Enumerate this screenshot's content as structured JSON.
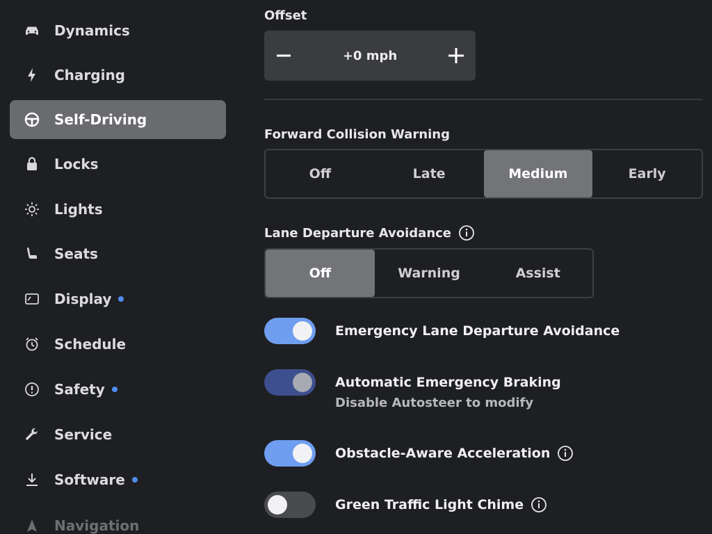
{
  "sidebar": {
    "items": [
      {
        "label": "Dynamics",
        "icon": "car-icon",
        "dot": false
      },
      {
        "label": "Charging",
        "icon": "bolt-icon",
        "dot": false
      },
      {
        "label": "Self-Driving",
        "icon": "steering-wheel-icon",
        "dot": false,
        "active": true
      },
      {
        "label": "Locks",
        "icon": "lock-icon",
        "dot": false
      },
      {
        "label": "Lights",
        "icon": "sun-icon",
        "dot": false
      },
      {
        "label": "Seats",
        "icon": "seat-icon",
        "dot": false
      },
      {
        "label": "Display",
        "icon": "display-icon",
        "dot": true
      },
      {
        "label": "Schedule",
        "icon": "alarm-clock-icon",
        "dot": false
      },
      {
        "label": "Safety",
        "icon": "alert-circle-icon",
        "dot": true
      },
      {
        "label": "Service",
        "icon": "wrench-icon",
        "dot": false
      },
      {
        "label": "Software",
        "icon": "download-icon",
        "dot": true
      },
      {
        "label": "Navigation",
        "icon": "navigation-arrow-icon",
        "dot": false
      }
    ]
  },
  "offset": {
    "label": "Offset",
    "value": "+0 mph",
    "minus": "−",
    "plus": "+"
  },
  "fcw": {
    "label": "Forward Collision Warning",
    "options": [
      "Off",
      "Late",
      "Medium",
      "Early"
    ],
    "selected": "Medium"
  },
  "lda": {
    "label": "Lane Departure Avoidance",
    "options": [
      "Off",
      "Warning",
      "Assist"
    ],
    "selected": "Off"
  },
  "toggles": [
    {
      "title": "Emergency Lane Departure Avoidance",
      "state": "on",
      "info": false
    },
    {
      "title": "Automatic Emergency Braking",
      "subtitle": "Disable Autosteer to modify",
      "state": "on-disabled",
      "info": false
    },
    {
      "title": "Obstacle-Aware Acceleration",
      "state": "on",
      "info": true
    },
    {
      "title": "Green Traffic Light Chime",
      "state": "off",
      "info": true
    }
  ],
  "colors": {
    "background": "#1e1f22",
    "accent_blue": "#6f9ef0",
    "dot_blue": "#4f8cf0",
    "selected_segment": "#737478"
  }
}
